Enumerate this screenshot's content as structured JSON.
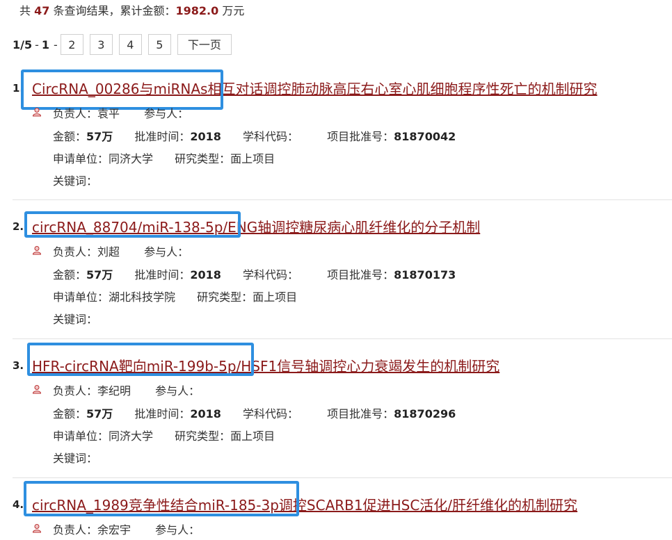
{
  "summary": {
    "prefix": "共",
    "count": "47",
    "middle": "条查询结果，累计金额：",
    "amount": "1982.0",
    "suffix": "万元"
  },
  "pager": {
    "current": "1",
    "total": "/5",
    "sep": "-",
    "cur_page": "1",
    "dash": "-",
    "pages": [
      "2",
      "3",
      "4",
      "5"
    ],
    "next_label": "下一页"
  },
  "labels": {
    "leader": "负责人：",
    "participants": "参与人：",
    "amount": "金额：",
    "approve_time": "批准时间：",
    "subject_code": "学科代码：",
    "approve_no": "项目批准号：",
    "institution": "申请单位：",
    "research_type": "研究类型：",
    "keywords": "关键词："
  },
  "results": [
    {
      "index": "1.",
      "title": "CircRNA_00286与miRNAs相互对话调控肺动脉高压右心室心肌细胞程序性死亡的机制研究",
      "leader": "袁平",
      "amount": "57万",
      "approve_time": "2018",
      "approve_no": "81870042",
      "institution": "同济大学",
      "research_type": "面上项目"
    },
    {
      "index": "2.",
      "title": "circRNA_88704/miR-138-5p/ENG轴调控糖尿病心肌纤维化的分子机制",
      "leader": "刘超",
      "amount": "57万",
      "approve_time": "2018",
      "approve_no": "81870173",
      "institution": "湖北科技学院",
      "research_type": "面上项目"
    },
    {
      "index": "3.",
      "title": "HFR-circRNA靶向miR-199b-5p/HSF1信号轴调控心力衰竭发生的机制研究",
      "leader": "李纪明",
      "amount": "57万",
      "approve_time": "2018",
      "approve_no": "81870296",
      "institution": "同济大学",
      "research_type": "面上项目"
    },
    {
      "index": "4.",
      "title": "circRNA_1989竞争性结合miR-185-3p调控SCARB1促进HSC活化/肝纤维化的机制研究",
      "leader": "余宏宇"
    }
  ],
  "colors": {
    "title": "#8b1a1a",
    "highlight": "#2e8fe0"
  }
}
